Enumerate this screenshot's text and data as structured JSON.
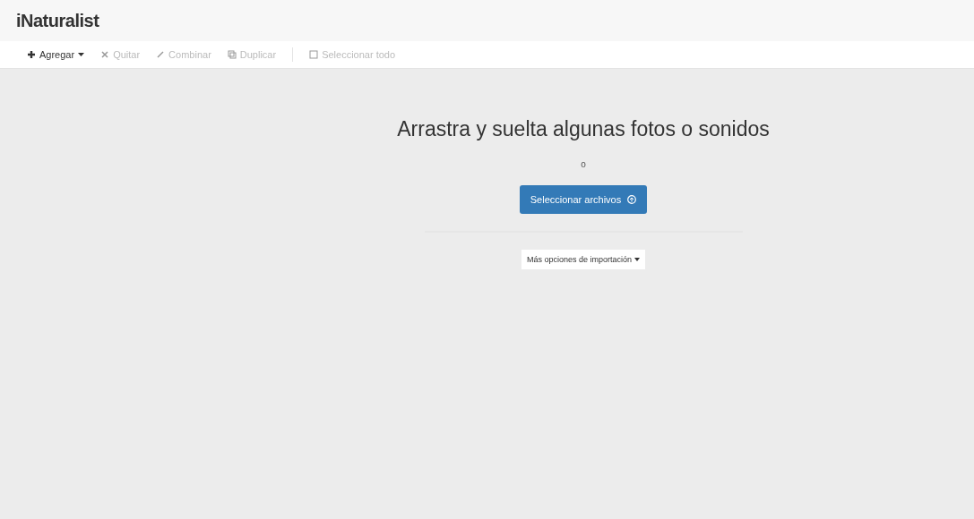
{
  "header": {
    "logo": "iNaturalist"
  },
  "toolbar": [
    {
      "label": "Agregar",
      "kind": "dropdown",
      "disabled": false
    },
    {
      "label": "Quitar",
      "kind": "remove",
      "disabled": true
    },
    {
      "label": "Combinar",
      "kind": "edit",
      "disabled": true
    },
    {
      "label": "Duplicar",
      "kind": "copy",
      "disabled": true
    },
    {
      "label": "Seleccionar todo",
      "kind": "check",
      "disabled": true
    }
  ],
  "dropzone": {
    "title": "Arrastra y suelta algunas fotos o sonidos",
    "or": "o",
    "select_button": "Seleccionar archivos",
    "more_options": "Más opciones de importación"
  }
}
